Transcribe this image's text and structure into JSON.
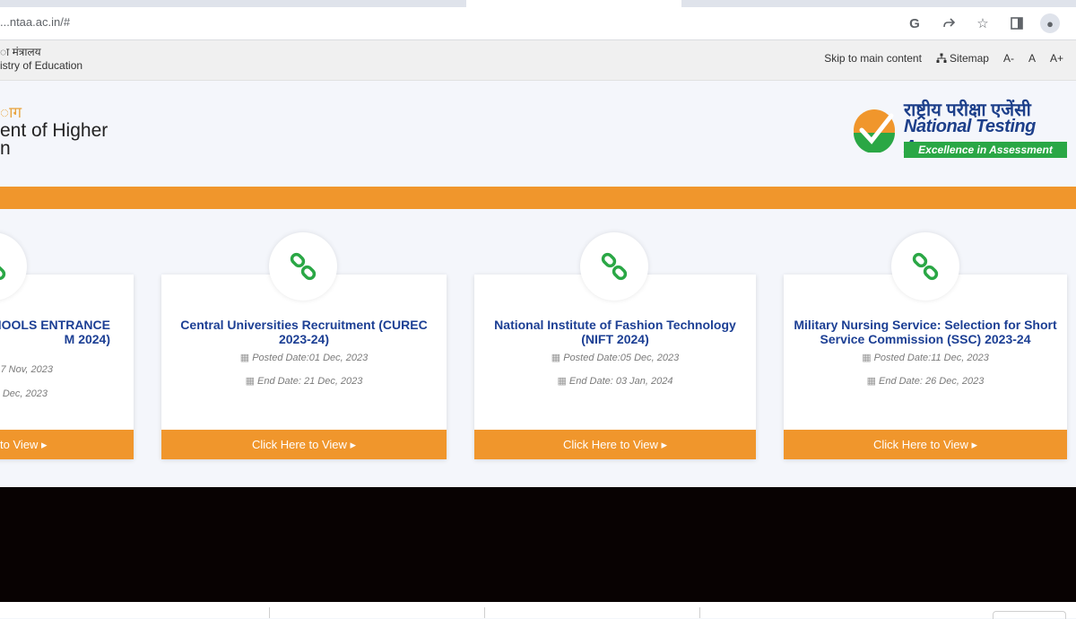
{
  "browser": {
    "url": "...ntaa.ac.in/#",
    "icons": [
      "google-icon",
      "share-icon",
      "star-icon",
      "sidebar-icon",
      "profile-icon"
    ]
  },
  "gov_bar": {
    "ministry_hindi": "ा मंत्रालय",
    "ministry_english": "istry of Education",
    "skip_link": "Skip to main content",
    "sitemap": "Sitemap",
    "font_minus": "A-",
    "font_normal": "A",
    "font_plus": "A+"
  },
  "header": {
    "dept_line1": "ाग",
    "dept_line2": "ent of Higher",
    "dept_line3": "n",
    "logo": {
      "hindi": "राष्ट्रीय परीक्षा एजेंसी",
      "english": "National Testing Agency",
      "tagline": "Excellence in Assessment"
    }
  },
  "cards": [
    {
      "title": "HOOLS ENTRANCE M 2024)",
      "posted": "7 Nov, 2023",
      "end": "Dec, 2023",
      "button": "to View"
    },
    {
      "title": "Central Universities Recruitment (CUREC 2023-24)",
      "posted": "Posted Date:01 Dec, 2023",
      "end": "End Date: 21 Dec, 2023",
      "button": "Click Here to View"
    },
    {
      "title": "National Institute of Fashion Technology (NIFT 2024)",
      "posted": "Posted Date:05 Dec, 2023",
      "end": "End Date: 03 Jan, 2024",
      "button": "Click Here to View"
    },
    {
      "title": "Military Nursing Service: Selection for Short Service Commission (SSC) 2023-24",
      "posted": "Posted Date:11 Dec, 2023",
      "end": "End Date: 26 Dec, 2023",
      "button": "Click Here to View"
    }
  ],
  "colors": {
    "orange": "#f0962c",
    "blue": "#1c3f94",
    "green": "#2aa745"
  }
}
